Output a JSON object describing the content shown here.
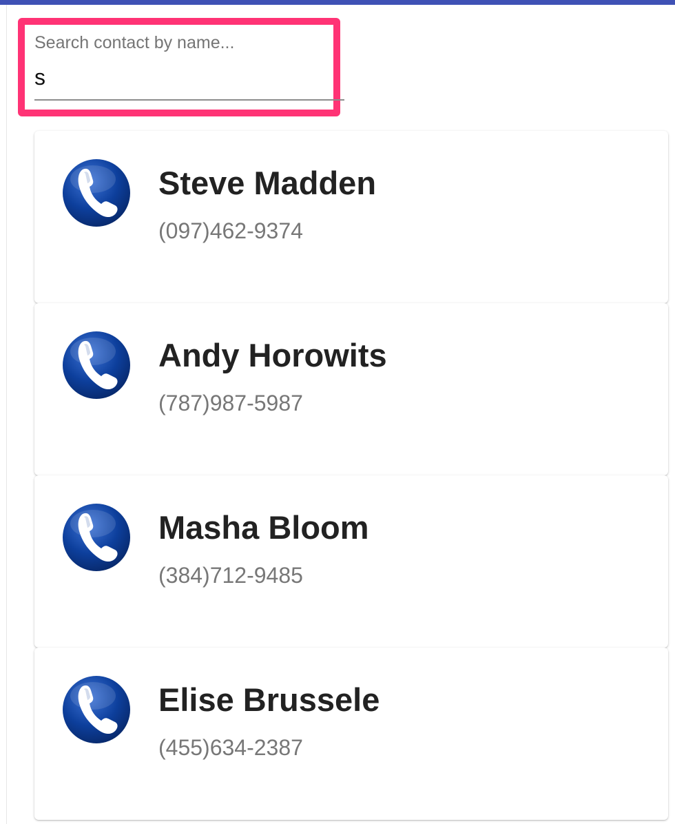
{
  "search": {
    "placeholder": "Search contact by name...",
    "value": "s"
  },
  "contacts": [
    {
      "name": "Steve Madden",
      "phone": "(097)462-9374",
      "icon": "phone-icon"
    },
    {
      "name": "Andy Horowits",
      "phone": "(787)987-5987",
      "icon": "phone-icon"
    },
    {
      "name": "Masha Bloom",
      "phone": "(384)712-9485",
      "icon": "phone-icon"
    },
    {
      "name": "Elise Brussele",
      "phone": "(455)634-2387",
      "icon": "phone-icon"
    }
  ],
  "colors": {
    "app_bar": "#3f51b5",
    "highlight": "#ff3375",
    "icon_blue": "#0d3f9c"
  }
}
